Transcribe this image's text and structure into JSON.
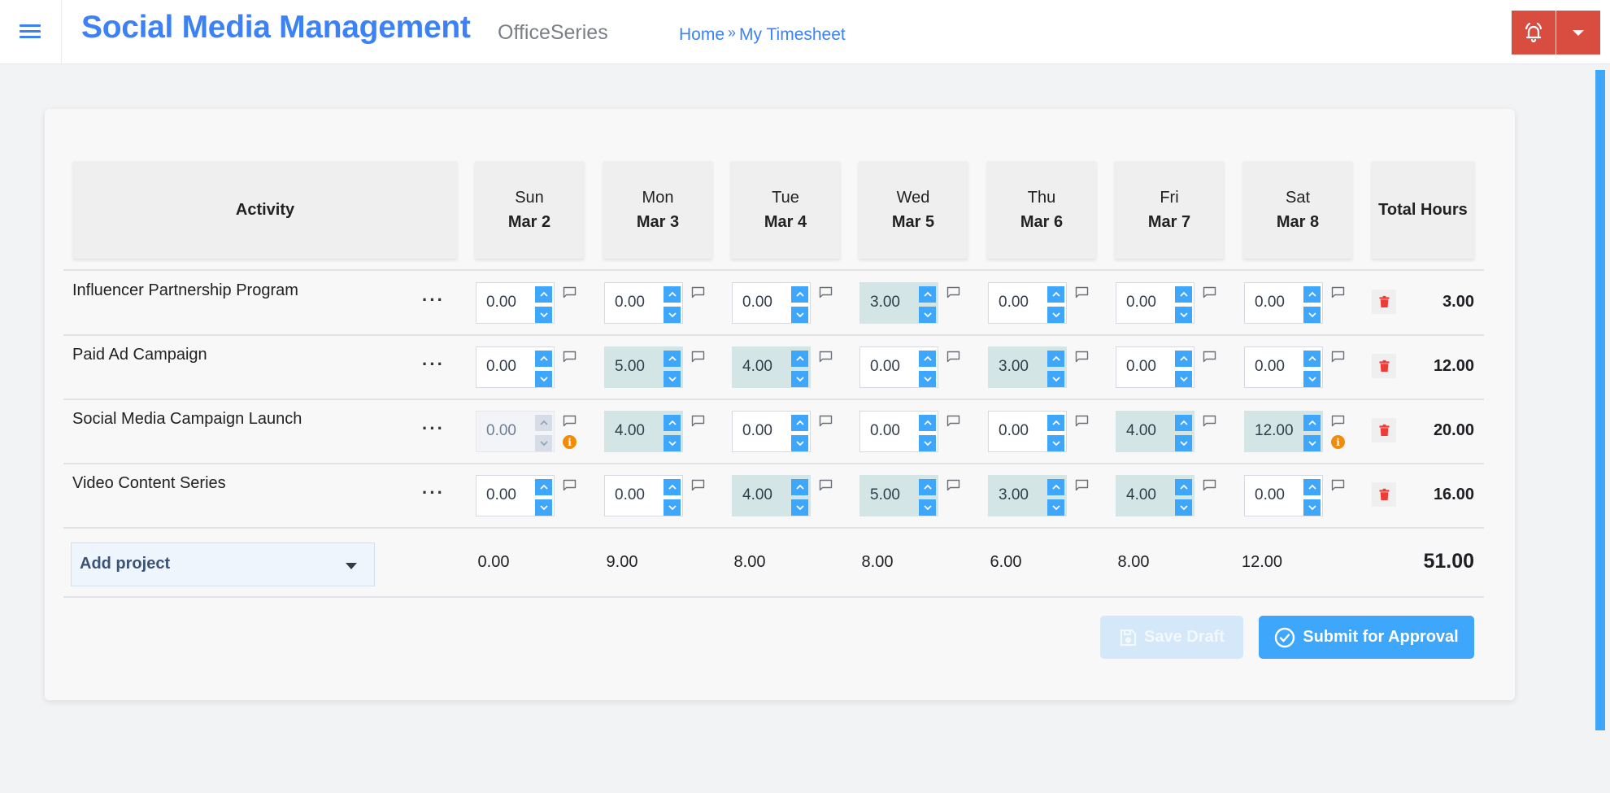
{
  "header": {
    "app_title": "Social Media Management",
    "suite_name": "OfficeSeries",
    "breadcrumb": [
      {
        "label": "Home"
      },
      {
        "label": "My Timesheet"
      }
    ],
    "breadcrumb_separator": "»",
    "menu_icon": "hamburger-icon",
    "alert_icon": "bell-alert-icon",
    "dropdown_icon": "caret-down-icon"
  },
  "timesheet": {
    "activity_header": "Activity",
    "total_header": "Total Hours",
    "days": [
      {
        "day": "Sun",
        "date": "Mar 2"
      },
      {
        "day": "Mon",
        "date": "Mar 3"
      },
      {
        "day": "Tue",
        "date": "Mar 4"
      },
      {
        "day": "Wed",
        "date": "Mar 5"
      },
      {
        "day": "Thu",
        "date": "Mar 6"
      },
      {
        "day": "Fri",
        "date": "Mar 7"
      },
      {
        "day": "Sat",
        "date": "Mar 8"
      }
    ],
    "rows": [
      {
        "activity": "Influencer Partnership Program",
        "more_label": "···",
        "hours": [
          "0.00",
          "0.00",
          "0.00",
          "3.00",
          "0.00",
          "0.00",
          "0.00"
        ],
        "disabled": [
          false,
          false,
          false,
          false,
          false,
          false,
          false
        ],
        "warnings": [
          false,
          false,
          false,
          false,
          false,
          false,
          false
        ],
        "total": "3.00"
      },
      {
        "activity": "Paid Ad Campaign",
        "more_label": "···",
        "hours": [
          "0.00",
          "5.00",
          "4.00",
          "0.00",
          "3.00",
          "0.00",
          "0.00"
        ],
        "disabled": [
          false,
          false,
          false,
          false,
          false,
          false,
          false
        ],
        "warnings": [
          false,
          false,
          false,
          false,
          false,
          false,
          false
        ],
        "total": "12.00"
      },
      {
        "activity": "Social Media Campaign Launch",
        "more_label": "···",
        "hours": [
          "0.00",
          "4.00",
          "0.00",
          "0.00",
          "0.00",
          "4.00",
          "12.00"
        ],
        "disabled": [
          true,
          false,
          false,
          false,
          false,
          false,
          false
        ],
        "warnings": [
          true,
          false,
          false,
          false,
          false,
          false,
          true
        ],
        "total": "20.00"
      },
      {
        "activity": "Video Content Series",
        "more_label": "···",
        "hours": [
          "0.00",
          "0.00",
          "4.00",
          "5.00",
          "3.00",
          "4.00",
          "0.00"
        ],
        "disabled": [
          false,
          false,
          false,
          false,
          false,
          false,
          false
        ],
        "warnings": [
          false,
          false,
          false,
          false,
          false,
          false,
          false
        ],
        "total": "16.00"
      }
    ],
    "add_project_label": "Add project",
    "day_totals": [
      "0.00",
      "9.00",
      "8.00",
      "8.00",
      "6.00",
      "8.00",
      "12.00"
    ],
    "grand_total": "51.00",
    "info_glyph": "i"
  },
  "actions": {
    "save_draft_label": "Save Draft",
    "save_draft_enabled": false,
    "submit_label": "Submit for Approval"
  },
  "colors": {
    "brand": "#3c82f6",
    "spinner": "#3ea6fb",
    "filled_cell": "#d3e6e5",
    "alert": "#d94c40",
    "warning": "#f28a0a",
    "delete": "#ef3b36"
  }
}
